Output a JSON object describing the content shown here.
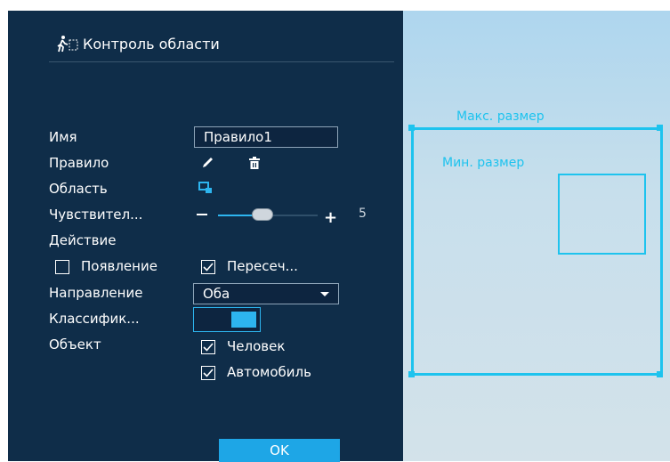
{
  "header": {
    "title": "Контроль области",
    "icon": "walking-person-icon"
  },
  "form": {
    "name_label": "Имя",
    "name_value": "Правило1",
    "rule_label": "Правило",
    "area_label": "Область",
    "sensitivity_label": "Чувствител...",
    "sensitivity_value": "5",
    "sensitivity_fraction": 0.5,
    "action_label": "Действие",
    "appear_label": "Появление",
    "appear_checked": false,
    "cross_label": "Пересеч...",
    "cross_checked": true,
    "direction_label": "Направление",
    "direction_value": "Оба",
    "classify_label": "Классифик...",
    "classify_on": true,
    "object_label": "Объект",
    "human_label": "Человек",
    "human_checked": true,
    "car_label": "Автомобиль",
    "car_checked": true,
    "ok_label": "OK"
  },
  "video": {
    "max_label": "Макс. размер",
    "min_label": "Мин. размер"
  },
  "colors": {
    "panel": "#0f2d49",
    "accent": "#1ea6e6",
    "box": "#1ec3ee"
  }
}
